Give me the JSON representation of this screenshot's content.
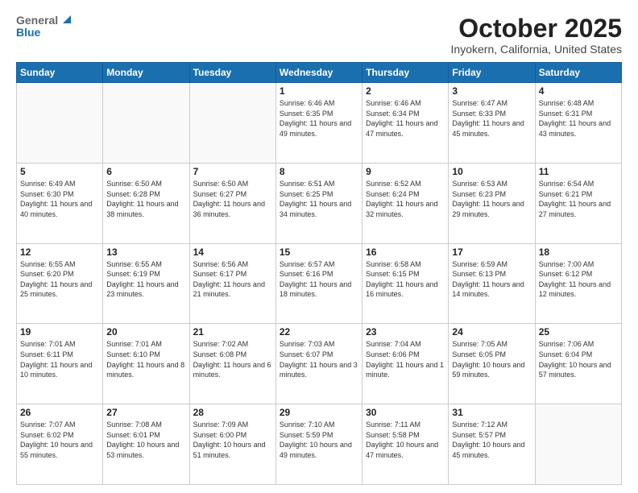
{
  "header": {
    "logo_general": "General",
    "logo_blue": "Blue",
    "month": "October 2025",
    "location": "Inyokern, California, United States"
  },
  "weekdays": [
    "Sunday",
    "Monday",
    "Tuesday",
    "Wednesday",
    "Thursday",
    "Friday",
    "Saturday"
  ],
  "weeks": [
    [
      {
        "day": "",
        "info": ""
      },
      {
        "day": "",
        "info": ""
      },
      {
        "day": "",
        "info": ""
      },
      {
        "day": "1",
        "info": "Sunrise: 6:46 AM\nSunset: 6:35 PM\nDaylight: 11 hours\nand 49 minutes."
      },
      {
        "day": "2",
        "info": "Sunrise: 6:46 AM\nSunset: 6:34 PM\nDaylight: 11 hours\nand 47 minutes."
      },
      {
        "day": "3",
        "info": "Sunrise: 6:47 AM\nSunset: 6:33 PM\nDaylight: 11 hours\nand 45 minutes."
      },
      {
        "day": "4",
        "info": "Sunrise: 6:48 AM\nSunset: 6:31 PM\nDaylight: 11 hours\nand 43 minutes."
      }
    ],
    [
      {
        "day": "5",
        "info": "Sunrise: 6:49 AM\nSunset: 6:30 PM\nDaylight: 11 hours\nand 40 minutes."
      },
      {
        "day": "6",
        "info": "Sunrise: 6:50 AM\nSunset: 6:28 PM\nDaylight: 11 hours\nand 38 minutes."
      },
      {
        "day": "7",
        "info": "Sunrise: 6:50 AM\nSunset: 6:27 PM\nDaylight: 11 hours\nand 36 minutes."
      },
      {
        "day": "8",
        "info": "Sunrise: 6:51 AM\nSunset: 6:25 PM\nDaylight: 11 hours\nand 34 minutes."
      },
      {
        "day": "9",
        "info": "Sunrise: 6:52 AM\nSunset: 6:24 PM\nDaylight: 11 hours\nand 32 minutes."
      },
      {
        "day": "10",
        "info": "Sunrise: 6:53 AM\nSunset: 6:23 PM\nDaylight: 11 hours\nand 29 minutes."
      },
      {
        "day": "11",
        "info": "Sunrise: 6:54 AM\nSunset: 6:21 PM\nDaylight: 11 hours\nand 27 minutes."
      }
    ],
    [
      {
        "day": "12",
        "info": "Sunrise: 6:55 AM\nSunset: 6:20 PM\nDaylight: 11 hours\nand 25 minutes."
      },
      {
        "day": "13",
        "info": "Sunrise: 6:55 AM\nSunset: 6:19 PM\nDaylight: 11 hours\nand 23 minutes."
      },
      {
        "day": "14",
        "info": "Sunrise: 6:56 AM\nSunset: 6:17 PM\nDaylight: 11 hours\nand 21 minutes."
      },
      {
        "day": "15",
        "info": "Sunrise: 6:57 AM\nSunset: 6:16 PM\nDaylight: 11 hours\nand 18 minutes."
      },
      {
        "day": "16",
        "info": "Sunrise: 6:58 AM\nSunset: 6:15 PM\nDaylight: 11 hours\nand 16 minutes."
      },
      {
        "day": "17",
        "info": "Sunrise: 6:59 AM\nSunset: 6:13 PM\nDaylight: 11 hours\nand 14 minutes."
      },
      {
        "day": "18",
        "info": "Sunrise: 7:00 AM\nSunset: 6:12 PM\nDaylight: 11 hours\nand 12 minutes."
      }
    ],
    [
      {
        "day": "19",
        "info": "Sunrise: 7:01 AM\nSunset: 6:11 PM\nDaylight: 11 hours\nand 10 minutes."
      },
      {
        "day": "20",
        "info": "Sunrise: 7:01 AM\nSunset: 6:10 PM\nDaylight: 11 hours\nand 8 minutes."
      },
      {
        "day": "21",
        "info": "Sunrise: 7:02 AM\nSunset: 6:08 PM\nDaylight: 11 hours\nand 6 minutes."
      },
      {
        "day": "22",
        "info": "Sunrise: 7:03 AM\nSunset: 6:07 PM\nDaylight: 11 hours\nand 3 minutes."
      },
      {
        "day": "23",
        "info": "Sunrise: 7:04 AM\nSunset: 6:06 PM\nDaylight: 11 hours\nand 1 minute."
      },
      {
        "day": "24",
        "info": "Sunrise: 7:05 AM\nSunset: 6:05 PM\nDaylight: 10 hours\nand 59 minutes."
      },
      {
        "day": "25",
        "info": "Sunrise: 7:06 AM\nSunset: 6:04 PM\nDaylight: 10 hours\nand 57 minutes."
      }
    ],
    [
      {
        "day": "26",
        "info": "Sunrise: 7:07 AM\nSunset: 6:02 PM\nDaylight: 10 hours\nand 55 minutes."
      },
      {
        "day": "27",
        "info": "Sunrise: 7:08 AM\nSunset: 6:01 PM\nDaylight: 10 hours\nand 53 minutes."
      },
      {
        "day": "28",
        "info": "Sunrise: 7:09 AM\nSunset: 6:00 PM\nDaylight: 10 hours\nand 51 minutes."
      },
      {
        "day": "29",
        "info": "Sunrise: 7:10 AM\nSunset: 5:59 PM\nDaylight: 10 hours\nand 49 minutes."
      },
      {
        "day": "30",
        "info": "Sunrise: 7:11 AM\nSunset: 5:58 PM\nDaylight: 10 hours\nand 47 minutes."
      },
      {
        "day": "31",
        "info": "Sunrise: 7:12 AM\nSunset: 5:57 PM\nDaylight: 10 hours\nand 45 minutes."
      },
      {
        "day": "",
        "info": ""
      }
    ]
  ]
}
